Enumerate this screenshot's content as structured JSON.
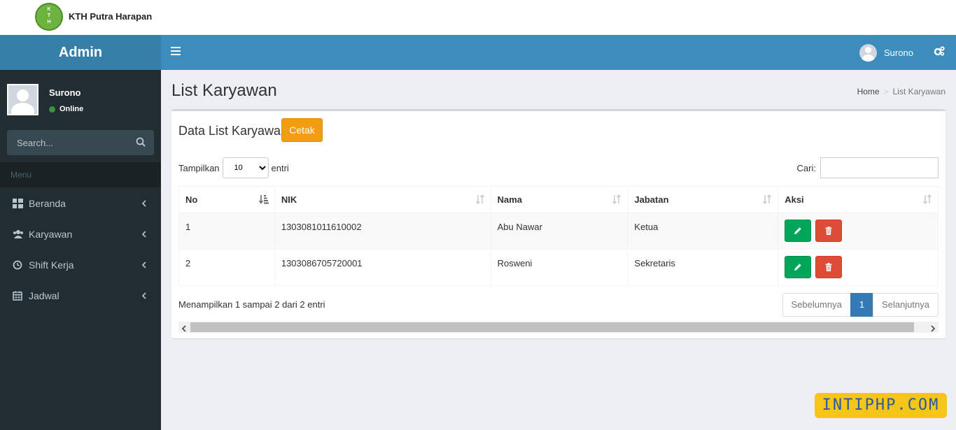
{
  "brand": {
    "logo_text": "K T H",
    "title": "KTH Putra Harapan"
  },
  "header": {
    "admin_label": "Admin",
    "user_name": "Surono"
  },
  "sidebar": {
    "user_name": "Surono",
    "status": "Online",
    "search_placeholder": "Search...",
    "menu_header": "Menu",
    "items": [
      {
        "label": "Beranda",
        "icon": "dashboard-icon"
      },
      {
        "label": "Karyawan",
        "icon": "users-icon"
      },
      {
        "label": "Shift Kerja",
        "icon": "clock-icon"
      },
      {
        "label": "Jadwal",
        "icon": "calendar-icon"
      }
    ]
  },
  "page": {
    "title": "List Karyawan",
    "breadcrumb": {
      "home": "Home",
      "current": "List Karyawan"
    }
  },
  "box": {
    "title": "Data List Karyawan",
    "print_button": "Cetak",
    "length_prefix": "Tampilkan",
    "length_value": "10",
    "length_suffix": "entri",
    "search_label": "Cari:"
  },
  "table": {
    "columns": [
      "No",
      "NIK",
      "Nama",
      "Jabatan",
      "Aksi"
    ],
    "rows": [
      {
        "no": "1",
        "nik": "1303081011610002",
        "nama": "Abu Nawar",
        "jabatan": "Ketua"
      },
      {
        "no": "2",
        "nik": "1303086705720001",
        "nama": "Rosweni",
        "jabatan": "Sekretaris"
      }
    ]
  },
  "footer": {
    "info": "Menampilkan 1 sampai 2 dari 2 entri",
    "prev": "Sebelumnya",
    "page": "1",
    "next": "Selanjutnya"
  },
  "watermark": "INTIPHP.COM",
  "colors": {
    "header": "#3c8dbc",
    "sidebar": "#222d32",
    "print_button": "#f39c12",
    "edit_button": "#00a65a",
    "delete_button": "#dd4b39",
    "active_page": "#337ab7"
  }
}
